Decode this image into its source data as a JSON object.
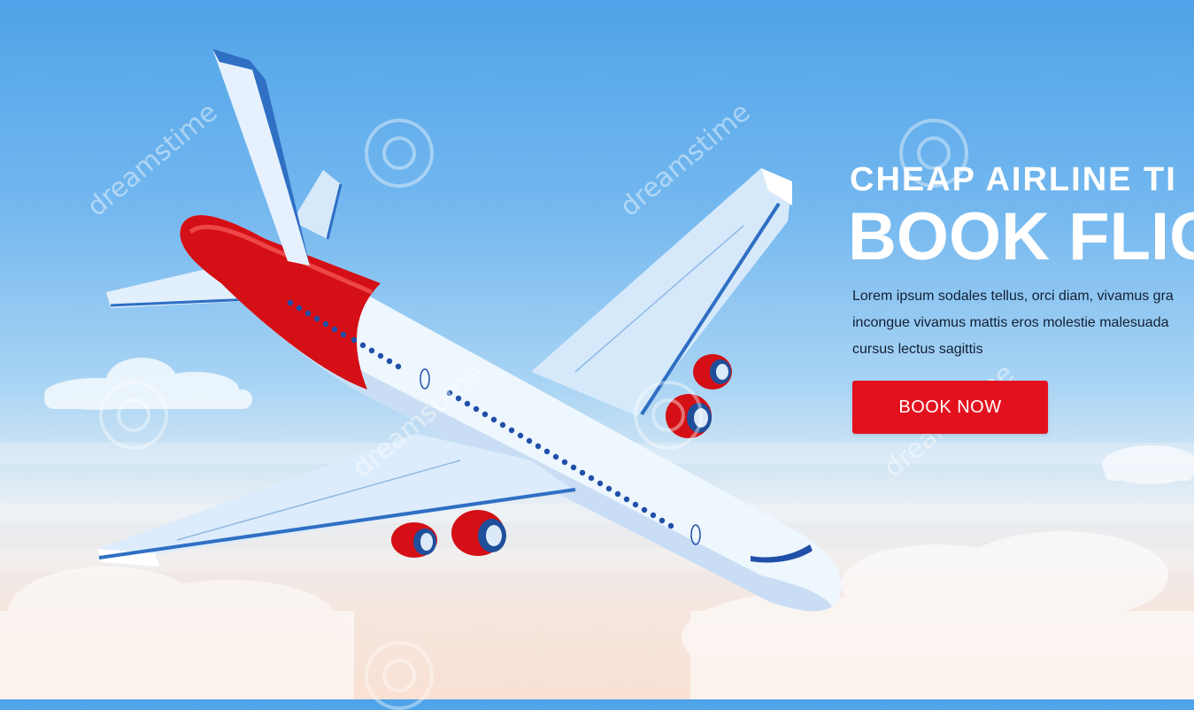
{
  "banner": {
    "headline_top": "CHEAP AIRLINE TI",
    "headline_main": "BOOK FLIG",
    "body_lines": [
      "Lorem ipsum sodales tellus, orci diam, vivamus gra",
      "incongue vivamus mattis eros molestie malesuada",
      "cursus lectus sagittis"
    ],
    "cta_label": "BOOK NOW"
  },
  "watermark": {
    "text": "dreamstime"
  },
  "colors": {
    "sky_top": "#4fa3e8",
    "cta": "#e3111e",
    "fuselage_red": "#d40f15",
    "wing_blue": "#2f6fc4"
  }
}
